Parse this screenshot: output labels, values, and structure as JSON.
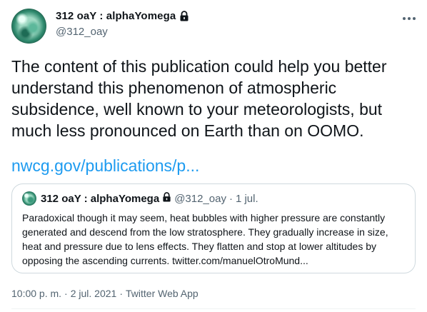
{
  "author": {
    "display_name": "312 oaY : alphaYomega",
    "handle": "@312_oay"
  },
  "tweet": {
    "text": "The content of this publication could help you better understand this phenomenon of atmospheric subsidence, well known to your meteorologists, but much less pronounced on Earth than on OOMO.",
    "link_text": "nwcg.gov/publications/p..."
  },
  "quote": {
    "display_name": "312 oaY : alphaYomega",
    "handle": "@312_oay",
    "separator": "·",
    "date": "1 jul.",
    "text": "Paradoxical though it may seem, heat bubbles with higher pressure are constantly generated and descend from the low stratosphere. They gradually increase in size, heat and pressure due to lens effects. They flatten and stop at lower altitudes by opposing the ascending currents. twitter.com/manuelOtroMund..."
  },
  "meta": {
    "time": "10:00 p. m.",
    "sep1": "·",
    "date": "2 jul. 2021",
    "sep2": "·",
    "source": "Twitter Web App"
  },
  "colors": {
    "link": "#1d9bf0",
    "secondary_text": "#536471",
    "border": "#cfd9de"
  },
  "icons": [
    "lock-icon",
    "more-icon"
  ]
}
